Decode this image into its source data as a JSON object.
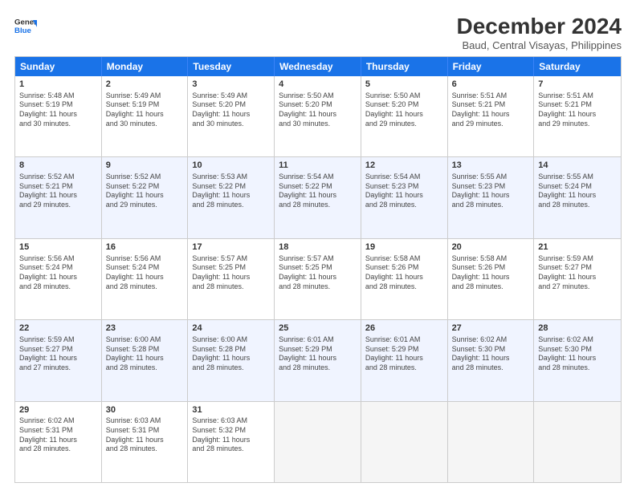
{
  "logo": {
    "line1": "General",
    "line2": "Blue"
  },
  "title": "December 2024",
  "subtitle": "Baud, Central Visayas, Philippines",
  "header_days": [
    "Sunday",
    "Monday",
    "Tuesday",
    "Wednesday",
    "Thursday",
    "Friday",
    "Saturday"
  ],
  "weeks": [
    {
      "alt": false,
      "cells": [
        {
          "day": "1",
          "lines": [
            "Sunrise: 5:48 AM",
            "Sunset: 5:19 PM",
            "Daylight: 11 hours",
            "and 30 minutes."
          ]
        },
        {
          "day": "2",
          "lines": [
            "Sunrise: 5:49 AM",
            "Sunset: 5:19 PM",
            "Daylight: 11 hours",
            "and 30 minutes."
          ]
        },
        {
          "day": "3",
          "lines": [
            "Sunrise: 5:49 AM",
            "Sunset: 5:20 PM",
            "Daylight: 11 hours",
            "and 30 minutes."
          ]
        },
        {
          "day": "4",
          "lines": [
            "Sunrise: 5:50 AM",
            "Sunset: 5:20 PM",
            "Daylight: 11 hours",
            "and 30 minutes."
          ]
        },
        {
          "day": "5",
          "lines": [
            "Sunrise: 5:50 AM",
            "Sunset: 5:20 PM",
            "Daylight: 11 hours",
            "and 29 minutes."
          ]
        },
        {
          "day": "6",
          "lines": [
            "Sunrise: 5:51 AM",
            "Sunset: 5:21 PM",
            "Daylight: 11 hours",
            "and 29 minutes."
          ]
        },
        {
          "day": "7",
          "lines": [
            "Sunrise: 5:51 AM",
            "Sunset: 5:21 PM",
            "Daylight: 11 hours",
            "and 29 minutes."
          ]
        }
      ]
    },
    {
      "alt": true,
      "cells": [
        {
          "day": "8",
          "lines": [
            "Sunrise: 5:52 AM",
            "Sunset: 5:21 PM",
            "Daylight: 11 hours",
            "and 29 minutes."
          ]
        },
        {
          "day": "9",
          "lines": [
            "Sunrise: 5:52 AM",
            "Sunset: 5:22 PM",
            "Daylight: 11 hours",
            "and 29 minutes."
          ]
        },
        {
          "day": "10",
          "lines": [
            "Sunrise: 5:53 AM",
            "Sunset: 5:22 PM",
            "Daylight: 11 hours",
            "and 28 minutes."
          ]
        },
        {
          "day": "11",
          "lines": [
            "Sunrise: 5:54 AM",
            "Sunset: 5:22 PM",
            "Daylight: 11 hours",
            "and 28 minutes."
          ]
        },
        {
          "day": "12",
          "lines": [
            "Sunrise: 5:54 AM",
            "Sunset: 5:23 PM",
            "Daylight: 11 hours",
            "and 28 minutes."
          ]
        },
        {
          "day": "13",
          "lines": [
            "Sunrise: 5:55 AM",
            "Sunset: 5:23 PM",
            "Daylight: 11 hours",
            "and 28 minutes."
          ]
        },
        {
          "day": "14",
          "lines": [
            "Sunrise: 5:55 AM",
            "Sunset: 5:24 PM",
            "Daylight: 11 hours",
            "and 28 minutes."
          ]
        }
      ]
    },
    {
      "alt": false,
      "cells": [
        {
          "day": "15",
          "lines": [
            "Sunrise: 5:56 AM",
            "Sunset: 5:24 PM",
            "Daylight: 11 hours",
            "and 28 minutes."
          ]
        },
        {
          "day": "16",
          "lines": [
            "Sunrise: 5:56 AM",
            "Sunset: 5:24 PM",
            "Daylight: 11 hours",
            "and 28 minutes."
          ]
        },
        {
          "day": "17",
          "lines": [
            "Sunrise: 5:57 AM",
            "Sunset: 5:25 PM",
            "Daylight: 11 hours",
            "and 28 minutes."
          ]
        },
        {
          "day": "18",
          "lines": [
            "Sunrise: 5:57 AM",
            "Sunset: 5:25 PM",
            "Daylight: 11 hours",
            "and 28 minutes."
          ]
        },
        {
          "day": "19",
          "lines": [
            "Sunrise: 5:58 AM",
            "Sunset: 5:26 PM",
            "Daylight: 11 hours",
            "and 28 minutes."
          ]
        },
        {
          "day": "20",
          "lines": [
            "Sunrise: 5:58 AM",
            "Sunset: 5:26 PM",
            "Daylight: 11 hours",
            "and 28 minutes."
          ]
        },
        {
          "day": "21",
          "lines": [
            "Sunrise: 5:59 AM",
            "Sunset: 5:27 PM",
            "Daylight: 11 hours",
            "and 27 minutes."
          ]
        }
      ]
    },
    {
      "alt": true,
      "cells": [
        {
          "day": "22",
          "lines": [
            "Sunrise: 5:59 AM",
            "Sunset: 5:27 PM",
            "Daylight: 11 hours",
            "and 27 minutes."
          ]
        },
        {
          "day": "23",
          "lines": [
            "Sunrise: 6:00 AM",
            "Sunset: 5:28 PM",
            "Daylight: 11 hours",
            "and 28 minutes."
          ]
        },
        {
          "day": "24",
          "lines": [
            "Sunrise: 6:00 AM",
            "Sunset: 5:28 PM",
            "Daylight: 11 hours",
            "and 28 minutes."
          ]
        },
        {
          "day": "25",
          "lines": [
            "Sunrise: 6:01 AM",
            "Sunset: 5:29 PM",
            "Daylight: 11 hours",
            "and 28 minutes."
          ]
        },
        {
          "day": "26",
          "lines": [
            "Sunrise: 6:01 AM",
            "Sunset: 5:29 PM",
            "Daylight: 11 hours",
            "and 28 minutes."
          ]
        },
        {
          "day": "27",
          "lines": [
            "Sunrise: 6:02 AM",
            "Sunset: 5:30 PM",
            "Daylight: 11 hours",
            "and 28 minutes."
          ]
        },
        {
          "day": "28",
          "lines": [
            "Sunrise: 6:02 AM",
            "Sunset: 5:30 PM",
            "Daylight: 11 hours",
            "and 28 minutes."
          ]
        }
      ]
    },
    {
      "alt": false,
      "cells": [
        {
          "day": "29",
          "lines": [
            "Sunrise: 6:02 AM",
            "Sunset: 5:31 PM",
            "Daylight: 11 hours",
            "and 28 minutes."
          ]
        },
        {
          "day": "30",
          "lines": [
            "Sunrise: 6:03 AM",
            "Sunset: 5:31 PM",
            "Daylight: 11 hours",
            "and 28 minutes."
          ]
        },
        {
          "day": "31",
          "lines": [
            "Sunrise: 6:03 AM",
            "Sunset: 5:32 PM",
            "Daylight: 11 hours",
            "and 28 minutes."
          ]
        },
        {
          "day": "",
          "lines": []
        },
        {
          "day": "",
          "lines": []
        },
        {
          "day": "",
          "lines": []
        },
        {
          "day": "",
          "lines": []
        }
      ]
    }
  ]
}
